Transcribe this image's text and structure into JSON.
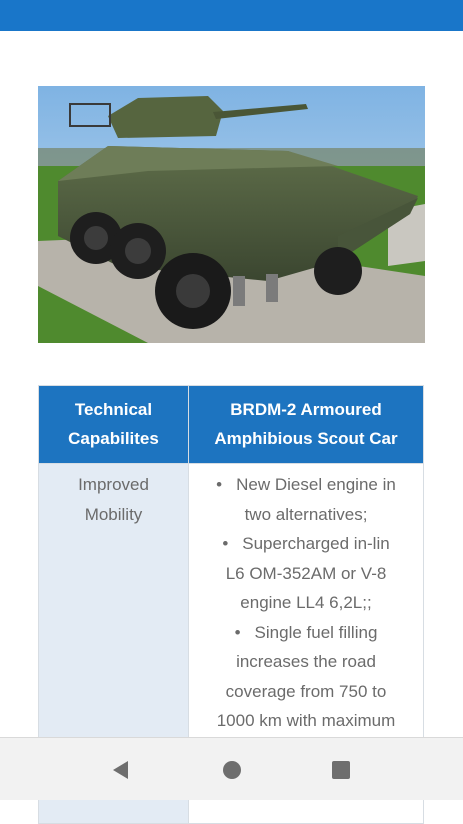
{
  "header": {
    "color": "#1976c9"
  },
  "image": {
    "subject": "armoured-vehicle-photo"
  },
  "table": {
    "headers": [
      "Technical Capabilites",
      "BRDM-2 Armoured Amphibious Scout Car"
    ],
    "rows": [
      {
        "capability": [
          "Improved",
          "Mobility"
        ],
        "details": [
          [
            "New Diesel engine in",
            "two alternatives;"
          ],
          [
            "Supercharged in-lin",
            "L6 OM-352AM or V-8",
            "engine LL4 6,2L;;"
          ],
          [
            "Single fuel filling",
            "increases the road",
            "coverage from 750 to",
            "1000 km with maximum"
          ]
        ]
      }
    ]
  },
  "nav": {
    "icons": [
      "back-icon",
      "home-icon",
      "recents-icon"
    ]
  },
  "colors": {
    "accent": "#1d74c0",
    "cell_tint": "#e3ebf4",
    "text": "#6b6b6b"
  }
}
